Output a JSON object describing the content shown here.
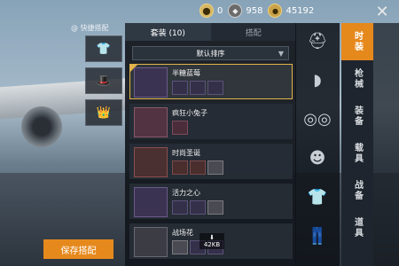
{
  "header": {
    "bp_amount": "0",
    "uc_amount": "958",
    "coin_amount": "45192",
    "close_glyph": "✕"
  },
  "nickname": "@ 快捷搭配",
  "tabs": [
    {
      "label": "套装 (10)",
      "active": true
    },
    {
      "label": "搭配",
      "active": false
    }
  ],
  "sort": {
    "label": "默认排序"
  },
  "items": [
    {
      "name": "半糖蓝莓",
      "selected": true,
      "part_count": 3
    },
    {
      "name": "疯狂小兔子",
      "selected": false,
      "part_count": 1
    },
    {
      "name": "时尚圣诞",
      "selected": false,
      "part_count": 3
    },
    {
      "name": "活力之心",
      "selected": false,
      "part_count": 3
    },
    {
      "name": "战场花",
      "selected": false,
      "part_count": 3,
      "download_size": "42KB"
    }
  ],
  "categories": [
    {
      "label": "时装",
      "active": true
    },
    {
      "label": "枪械",
      "active": false
    },
    {
      "label": "装备",
      "active": false
    },
    {
      "label": "载具",
      "active": false
    },
    {
      "label": "战备",
      "active": false
    },
    {
      "label": "道具",
      "active": false
    }
  ],
  "save_button": "保存搭配",
  "colors": {
    "accent": "#e6891d",
    "selected_border": "#e2b44a"
  }
}
